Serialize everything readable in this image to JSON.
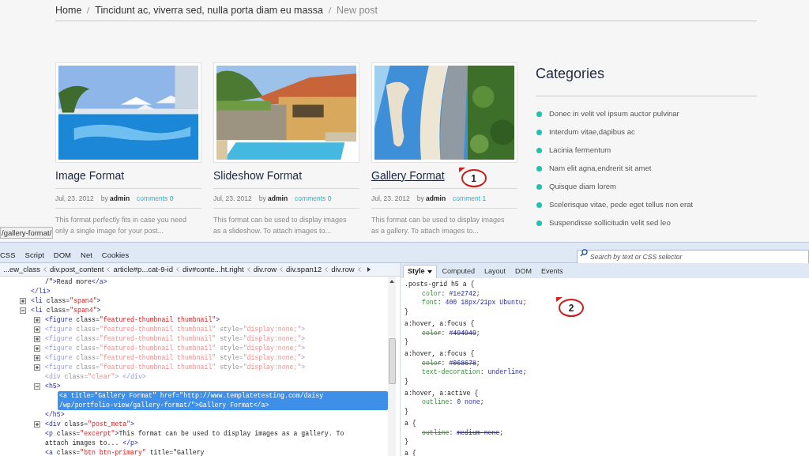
{
  "breadcrumb": [
    {
      "label": "Home",
      "current": false
    },
    {
      "label": "Tincidunt ac, viverra sed, nulla porta diam eu massa",
      "current": false
    },
    {
      "label": "New post",
      "current": true
    }
  ],
  "posts": [
    {
      "title": "Image Format",
      "hovered": false,
      "date": "Jul, 23. 2012",
      "by": "by",
      "author": "admin",
      "comments": "comments 0",
      "excerpt": [
        "This format perfectly fits in case you need",
        "only a single image for your post..."
      ]
    },
    {
      "title": "Slideshow Format",
      "hovered": false,
      "date": "Jul, 23. 2012",
      "by": "by",
      "author": "admin",
      "comments": "comments 0",
      "excerpt": [
        "This format can be used to display images",
        "as a slideshow. To attach images to..."
      ]
    },
    {
      "title": "Gallery Format",
      "hovered": true,
      "annotation": "1",
      "date": "Jul, 23. 2012",
      "by": "by",
      "author": "admin",
      "comments": "comment 1",
      "excerpt": [
        "This format can be used to display images",
        "as a gallery. To attach images to..."
      ]
    }
  ],
  "categories": {
    "title": "Categories",
    "items": [
      "Donec in velit vel ipsum auctor pulvinar",
      "Interdum vitae,dapibus ac",
      "Lacinia fermentum",
      "Nam elit agna,endrerit sit amet",
      "Quisque diam lorem",
      "Scelerisque vitae, pede eget tellus non erat",
      "Suspendisse sollicitudin velit sed leo"
    ]
  },
  "status_url": "/gallery-format/",
  "devtools": {
    "panel_tabs": [
      {
        "label": "CSS",
        "selected": false
      },
      {
        "label": "Script",
        "selected": false
      },
      {
        "label": "DOM",
        "selected": false
      },
      {
        "label": "Net",
        "selected": false
      },
      {
        "label": "Cookies",
        "selected": false
      }
    ],
    "search": {
      "placeholder": "Search by text or CSS selector"
    },
    "path": [
      "...ew_class",
      "div.post_content",
      "article#p...cat-9-id",
      "div#conte...ht.right",
      "div.row",
      "div.span12",
      "div.row"
    ],
    "html_tree": [
      {
        "children": [
          {
            "lines": [
              "/\">Read more</a>"
            ],
            "selected": false
          }
        ],
        "close": "</li>"
      },
      {
        "lines": [
          "<li class=\"span4\">"
        ],
        "expanded": false,
        "selected": false
      },
      {
        "lines": [
          "<li class=\"span4\">"
        ],
        "expanded": true,
        "selected": false,
        "children": [
          {
            "lines": [
              "<figure class=\"featured-thumbnail thumbnail\">"
            ],
            "expanded": false,
            "dimmed": false,
            "selected": false
          },
          {
            "lines": [
              "<figure class=\"featured-thumbnail thumbnail\" style=\"display:none;\">"
            ],
            "expanded": false,
            "dimmed": true,
            "selected": false
          },
          {
            "lines": [
              "<figure class=\"featured-thumbnail thumbnail\" style=\"display:none;\">"
            ],
            "expanded": false,
            "dimmed": true,
            "selected": false
          },
          {
            "lines": [
              "<figure class=\"featured-thumbnail thumbnail\" style=\"display:none;\">"
            ],
            "expanded": false,
            "dimmed": true,
            "selected": false
          },
          {
            "lines": [
              "<figure class=\"featured-thumbnail thumbnail\" style=\"display:none;\">"
            ],
            "expanded": false,
            "dimmed": true,
            "selected": false
          },
          {
            "lines": [
              "<figure class=\"featured-thumbnail thumbnail\" style=\"display:none;\">"
            ],
            "expanded": false,
            "dimmed": true,
            "selected": false
          },
          {
            "lines": [
              "<div class=\"clear\"> </div>"
            ],
            "dimmed": true,
            "selected": false
          },
          {
            "lines": [
              "<h5>"
            ],
            "expanded": true,
            "dimmed": false,
            "selected": false,
            "children": [
              {
                "lines": [
                  "<a title=\"Gallery Format\" href=\"http://www.templatetesting.com/daisy",
                  "/wp/portfolio-view/gallery-format/\">Gallery Format</a>"
                ],
                "selected": true
              }
            ],
            "close": "</h5>"
          },
          {
            "lines": [
              "<div class=\"post_meta\">"
            ],
            "expanded": false,
            "dimmed": false,
            "selected": false
          },
          {
            "lines": [
              "<p class=\"excerpt\">This format can be used to display images as a gallery. To",
              "attach images to... </p>"
            ],
            "dimmed": false,
            "selected": false
          },
          {
            "lines": [
              "<a class=\"btn btn-primary\" title=\"Gallery"
            ],
            "dimmed": false,
            "selected": false
          }
        ]
      }
    ],
    "side_tabs": [
      {
        "label": "Style",
        "selected": true,
        "menu": true
      },
      {
        "label": "Computed",
        "selected": false,
        "menu": false
      },
      {
        "label": "Layout",
        "selected": false,
        "menu": false
      },
      {
        "label": "DOM",
        "selected": false,
        "menu": false
      },
      {
        "label": "Events",
        "selected": false,
        "menu": false
      }
    ],
    "css_rules": [
      {
        "selector": ".posts-grid h5 a {",
        "declarations": [
          {
            "text": "color: #1e2742;",
            "overridden": false
          },
          {
            "text": "font: 400 18px/21px Ubuntu;",
            "overridden": false
          }
        ],
        "close": "}"
      },
      {
        "selector": "a:hover, a:focus {",
        "declarations": [
          {
            "text": "color: #494949;",
            "overridden": true
          }
        ],
        "close": "}"
      },
      {
        "selector": "a:hover, a:focus {",
        "declarations": [
          {
            "text": "color: #068678;",
            "overridden": true
          },
          {
            "text": "text-decoration: underline;",
            "overridden": false
          }
        ],
        "close": "}"
      },
      {
        "selector": "a:hover, a:active {",
        "declarations": [
          {
            "text": "outline: 0 none;",
            "overridden": false
          }
        ],
        "close": "}"
      },
      {
        "selector": "a {",
        "declarations": [
          {
            "text": "outline: medium none;",
            "overridden": true
          }
        ],
        "close": "}"
      },
      {
        "selector": "a {"
      }
    ],
    "annotation": "2"
  }
}
